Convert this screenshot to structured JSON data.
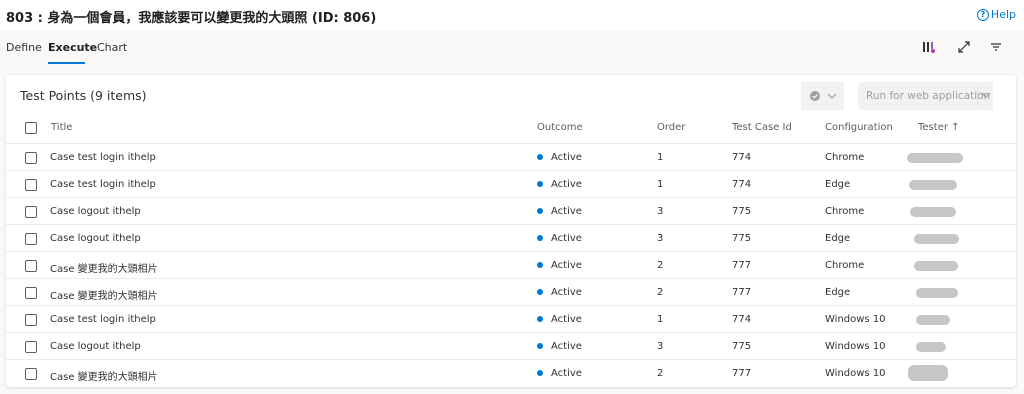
{
  "header": {
    "title": "803 : 身為一個會員，我應該要可以變更我的大頭照 (ID: 806)",
    "help_label": "Help"
  },
  "tabs": [
    {
      "label": "Define",
      "selected": false
    },
    {
      "label": "Execute",
      "selected": true
    },
    {
      "label": "Chart",
      "selected": false
    }
  ],
  "toolbar_icons": [
    "bar-chart-settings-icon",
    "expand-icon",
    "filter-icon"
  ],
  "card": {
    "title": "Test Points (9 items)",
    "run_button_label": "Run for web application"
  },
  "columns": [
    "Title",
    "Outcome",
    "Order",
    "Test Case Id",
    "Configuration",
    "Tester ↑"
  ],
  "rows": [
    {
      "title": "Case test login ithelp",
      "outcome": "Active",
      "order": "1",
      "test_case_id": "774",
      "configuration": "Chrome"
    },
    {
      "title": "Case test login ithelp",
      "outcome": "Active",
      "order": "1",
      "test_case_id": "774",
      "configuration": "Edge"
    },
    {
      "title": "Case logout ithelp",
      "outcome": "Active",
      "order": "3",
      "test_case_id": "775",
      "configuration": "Chrome"
    },
    {
      "title": "Case logout ithelp",
      "outcome": "Active",
      "order": "3",
      "test_case_id": "775",
      "configuration": "Edge"
    },
    {
      "title": "Case 變更我的大頭相片",
      "outcome": "Active",
      "order": "2",
      "test_case_id": "777",
      "configuration": "Chrome"
    },
    {
      "title": "Case 變更我的大頭相片",
      "outcome": "Active",
      "order": "2",
      "test_case_id": "777",
      "configuration": "Edge"
    },
    {
      "title": "Case test login ithelp",
      "outcome": "Active",
      "order": "1",
      "test_case_id": "774",
      "configuration": "Windows 10"
    },
    {
      "title": "Case logout ithelp",
      "outcome": "Active",
      "order": "3",
      "test_case_id": "775",
      "configuration": "Windows 10"
    },
    {
      "title": "Case 變更我的大頭相片",
      "outcome": "Active",
      "order": "2",
      "test_case_id": "777",
      "configuration": "Windows 10"
    }
  ],
  "colors": {
    "accent": "#0078d4",
    "active_dot": "#0078d4",
    "redacted": "#c8c6c4"
  }
}
